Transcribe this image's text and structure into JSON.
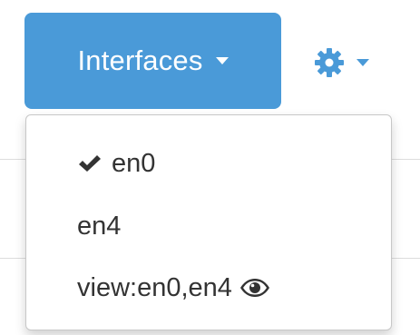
{
  "toolbar": {
    "interfaces_label": "Interfaces",
    "settings_icon": "gear-icon"
  },
  "menu": {
    "items": [
      {
        "label": "en0",
        "selected": true,
        "icon": "checkmark-icon"
      },
      {
        "label": "en4",
        "selected": false
      },
      {
        "label": "view:en0,en4",
        "selected": false,
        "icon": "eye-icon"
      }
    ]
  },
  "colors": {
    "accent": "#4a9ad8",
    "text": "#333333",
    "button_text": "#ffffff"
  }
}
